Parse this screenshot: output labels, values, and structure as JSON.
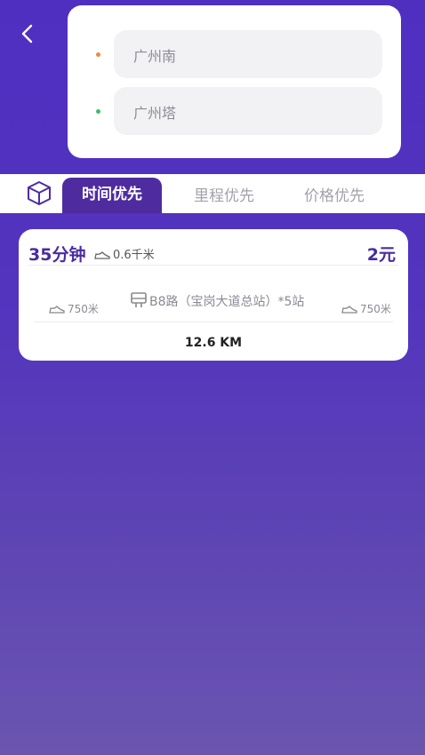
{
  "route": {
    "origin": "广州南",
    "destination": "广州塔"
  },
  "tabs": {
    "items": [
      "时间优先",
      "里程优先",
      "价格优先"
    ],
    "active_index": 0
  },
  "result": {
    "duration": "35分钟",
    "walk_total": "0.6千米",
    "price": "2元",
    "walk_start": "750米",
    "bus_line": "B8路（宝岗大道总站）*5站",
    "walk_end": "750米",
    "distance": "12.6 KM"
  },
  "colors": {
    "background": "#4f2fc0",
    "accent": "#4e2c9f",
    "origin_dot": "#f0893a",
    "destination_dot": "#3dbb6e"
  },
  "icons": {
    "back": "chevron-left-icon",
    "mode": "cube-icon",
    "walk": "shoe-icon",
    "bus": "bus-icon"
  }
}
